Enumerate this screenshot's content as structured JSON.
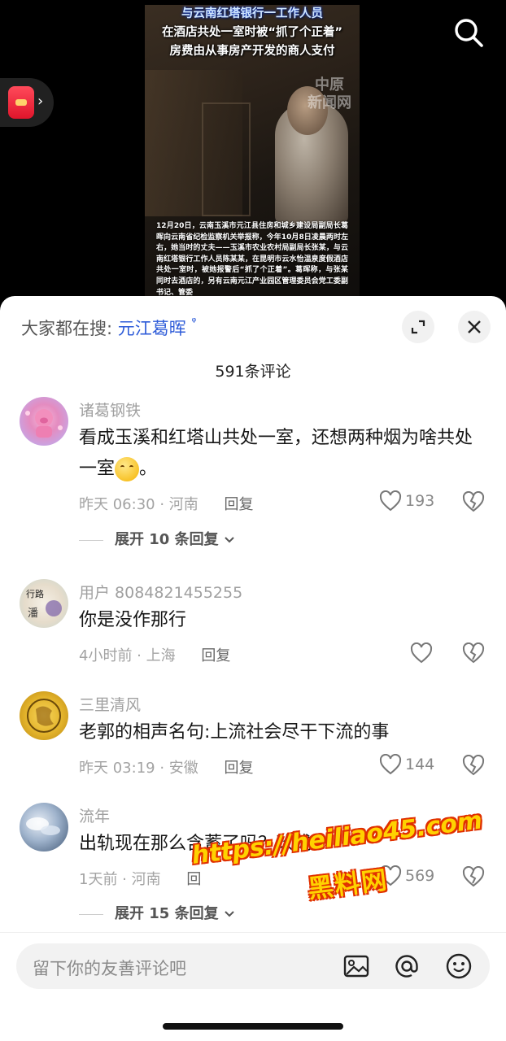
{
  "video": {
    "title_lines": [
      "与云南红塔银行一工作人员",
      "在酒店共处一室时被“抓了个正着”",
      "房费由从事房产开发的商人支付"
    ],
    "watermark": [
      "中原",
      "新闻网"
    ],
    "caption": "12月20日，云南玉溪市元江县住房和城乡建设局副局长葛晖向云南省纪检监察机关举报称，今年10月8日凌晨两时左右，她当时的丈夫——玉溪市农业农村局副局长张某，与云南红塔银行工作人员陈某某，在昆明市云水怡温泉度假酒店共处一室时，被她报警后“抓了个正着”。葛晖称，与张某同时去酒店的，另有云南元江产业园区管理委员会党工委副书记、管委"
  },
  "top": {
    "search_icon": "search-icon",
    "red_packet_icon": "red-packet-icon",
    "chevron": "›"
  },
  "sheet": {
    "search_prefix": "大家都在搜:",
    "search_term": "元江葛晖",
    "search_suffix": "ᵠ",
    "comment_count": "591条评论"
  },
  "comments": [
    {
      "user": "诸葛钢铁",
      "text": "看成玉溪和红塔山共处一室，还想两种烟为啥共处一室",
      "text_end": "。",
      "meta": "昨天 06:30 · 河南",
      "reply": "回复",
      "likes": "193",
      "expand": "展开 10 条回复"
    },
    {
      "user": "用户 8084821455255",
      "text": "你是没作那行",
      "meta": "4小时前 · 上海",
      "reply": "回复"
    },
    {
      "user": "三里清风",
      "text": "老郭的相声名句:上流社会尽干下流的事",
      "meta": "昨天 03:19 · 安徽",
      "reply": "回复",
      "likes": "144"
    },
    {
      "user": "流年",
      "text": "出轨现在那么含蓄了吗？改成",
      "meta": "1天前 · 河南",
      "reply": "回",
      "likes": "569",
      "expand": "展开 15 条回复"
    }
  ],
  "overlay": {
    "url": "https://heiliao45.com",
    "name": "黑料网"
  },
  "input": {
    "placeholder": "留下你的友善评论吧"
  },
  "colors": {
    "accent_blue": "#2d5bd8",
    "watermark_yellow": "#ffd200",
    "watermark_red": "#e03000"
  }
}
